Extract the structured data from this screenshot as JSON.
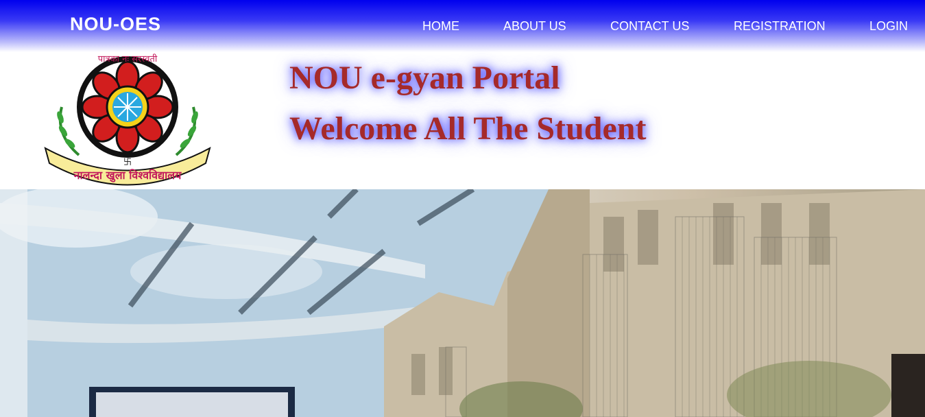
{
  "navbar": {
    "brand": "NOU-OES",
    "items": [
      {
        "label": "HOME"
      },
      {
        "label": "ABOUT US"
      },
      {
        "label": "CONTACT US"
      },
      {
        "label": "REGISTRATION"
      },
      {
        "label": "LOGIN"
      }
    ]
  },
  "logo": {
    "motto": "पात्रका नः सरस्वती",
    "banner": "नालन्दा खुला विश्वविद्यालय"
  },
  "header": {
    "line1": "NOU e-gyan Portal",
    "line2": "Welcome All The Student"
  },
  "hero": {
    "icon": "campus-collage-image"
  },
  "colors": {
    "nav_blue": "#0000ee",
    "headline": "#a52a2a",
    "glow": "#3030ff"
  }
}
